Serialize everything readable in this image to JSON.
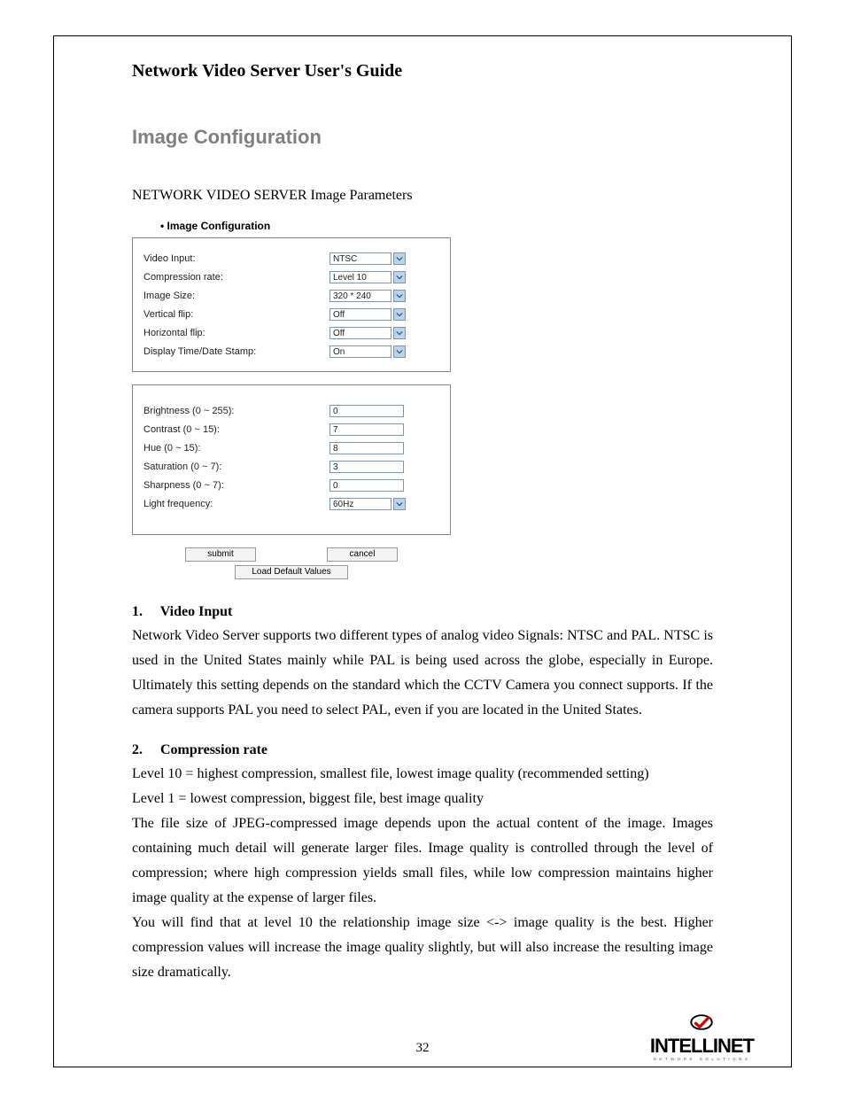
{
  "doc_title": "Network Video Server User's Guide",
  "section_title": "Image Configuration",
  "sub_heading": "NETWORK VIDEO SERVER Image Parameters",
  "config_header": "Image Configuration",
  "panel1": {
    "rows": [
      {
        "label": "Video Input:",
        "value": "NTSC"
      },
      {
        "label": "Compression rate:",
        "value": "Level 10"
      },
      {
        "label": "Image Size:",
        "value": "320 * 240"
      },
      {
        "label": "Vertical flip:",
        "value": "Off"
      },
      {
        "label": "Horizontal flip:",
        "value": "Off"
      },
      {
        "label": "Display Time/Date Stamp:",
        "value": "On"
      }
    ]
  },
  "panel2": {
    "rows": [
      {
        "label": "Brightness (0 ~ 255):",
        "value": "0",
        "type": "text"
      },
      {
        "label": "Contrast (0 ~ 15):",
        "value": "7",
        "type": "text"
      },
      {
        "label": "Hue (0 ~ 15):",
        "value": "8",
        "type": "text"
      },
      {
        "label": "Saturation (0 ~ 7):",
        "value": "3",
        "type": "text"
      },
      {
        "label": "Sharpness (0 ~ 7):",
        "value": "0",
        "type": "text"
      },
      {
        "label": "Light frequency:",
        "value": "60Hz",
        "type": "select"
      }
    ]
  },
  "buttons": {
    "submit": "submit",
    "cancel": "cancel",
    "load_default": "Load Default Values"
  },
  "item1": {
    "num": "1.",
    "title": "Video Input",
    "body": "Network Video Server supports two different types of analog video Signals: NTSC and PAL. NTSC is used in the United States mainly while PAL is being used across the globe, especially in Europe. Ultimately this setting depends on the standard which the CCTV Camera you connect supports. If the camera supports PAL you need to select PAL, even if you are located in the United States."
  },
  "item2": {
    "num": "2.",
    "title": "Compression rate",
    "body_a": "Level 10 = highest compression, smallest file, lowest image quality (recommended setting)",
    "body_b": "Level 1 = lowest compression, biggest file, best image quality",
    "body_c": "The file size of JPEG-compressed image depends upon the actual content of the image. Images containing much detail will generate larger files. Image quality is controlled through the level of compression; where high compression yields small files, while low compression maintains higher image quality at the expense of larger files.",
    "body_d": "You will find that at level 10 the relationship image size <-> image quality is the best. Higher compression values will increase the image quality slightly, but will also increase the resulting image size dramatically."
  },
  "page_number": "32",
  "logo": {
    "text": "INTELLINET",
    "tagline": "NETWORK SOLUTIONS"
  }
}
